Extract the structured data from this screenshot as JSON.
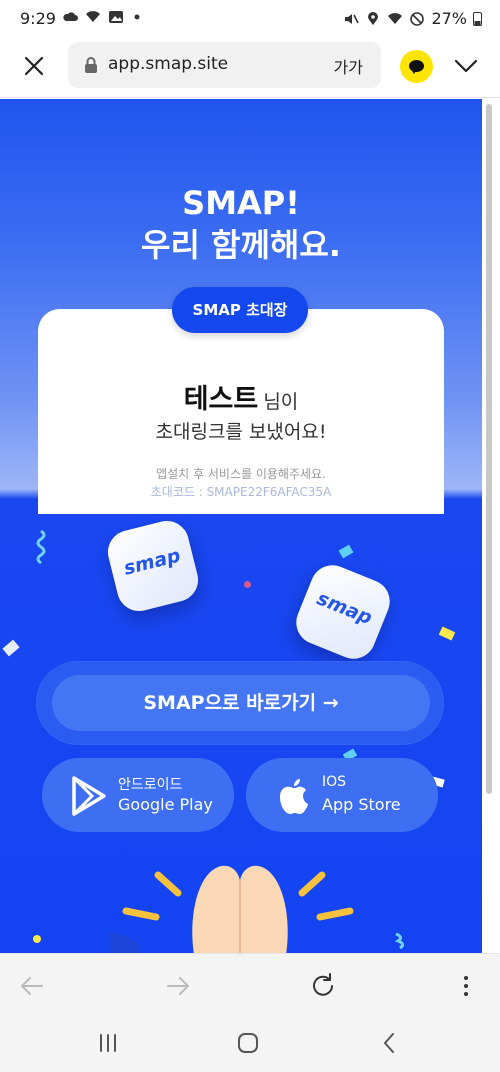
{
  "status_bar": {
    "time": "9:29",
    "battery": "27%",
    "left_icons": [
      "cloud-icon",
      "wifi-icon",
      "image-icon",
      "dot-icon"
    ],
    "right_icons": [
      "mute-icon",
      "location-icon",
      "wifi-icon",
      "dnd-icon",
      "battery-icon"
    ]
  },
  "browser": {
    "url": "app.smap.site",
    "text_size_label": "가가",
    "close_icon": "close-icon",
    "kakao_icon": "kakao-talk-icon",
    "menu_icon": "chevron-down-icon"
  },
  "hero": {
    "title_line1": "SMAP!",
    "title_line2": "우리 함께해요."
  },
  "invite": {
    "pill_label": "SMAP 초대장",
    "name": "테스트",
    "honorific": "님이",
    "message": "초대링크를 보냈어요!",
    "note": "앱설치 후 서비스를 이용해주세요.",
    "code": "초대코드 : SMAPE22F6AFAC35A"
  },
  "app_icons": {
    "label": "smap"
  },
  "cta": {
    "label": "SMAP으로 바로가기 →"
  },
  "stores": [
    {
      "line1": "안드로이드",
      "line2": "Google Play",
      "icon": "google-play-icon"
    },
    {
      "line1": "IOS",
      "line2": "App Store",
      "icon": "apple-icon"
    }
  ],
  "bottom_bar": {
    "icons": [
      "back-arrow-icon",
      "forward-arrow-icon",
      "refresh-icon",
      "more-vertical-icon"
    ]
  },
  "system_nav": {
    "icons": [
      "recent-apps-icon",
      "home-icon",
      "back-icon"
    ]
  },
  "colors": {
    "primary": "#1444f2",
    "pill": "#1348ee",
    "kakao": "#fee500"
  }
}
